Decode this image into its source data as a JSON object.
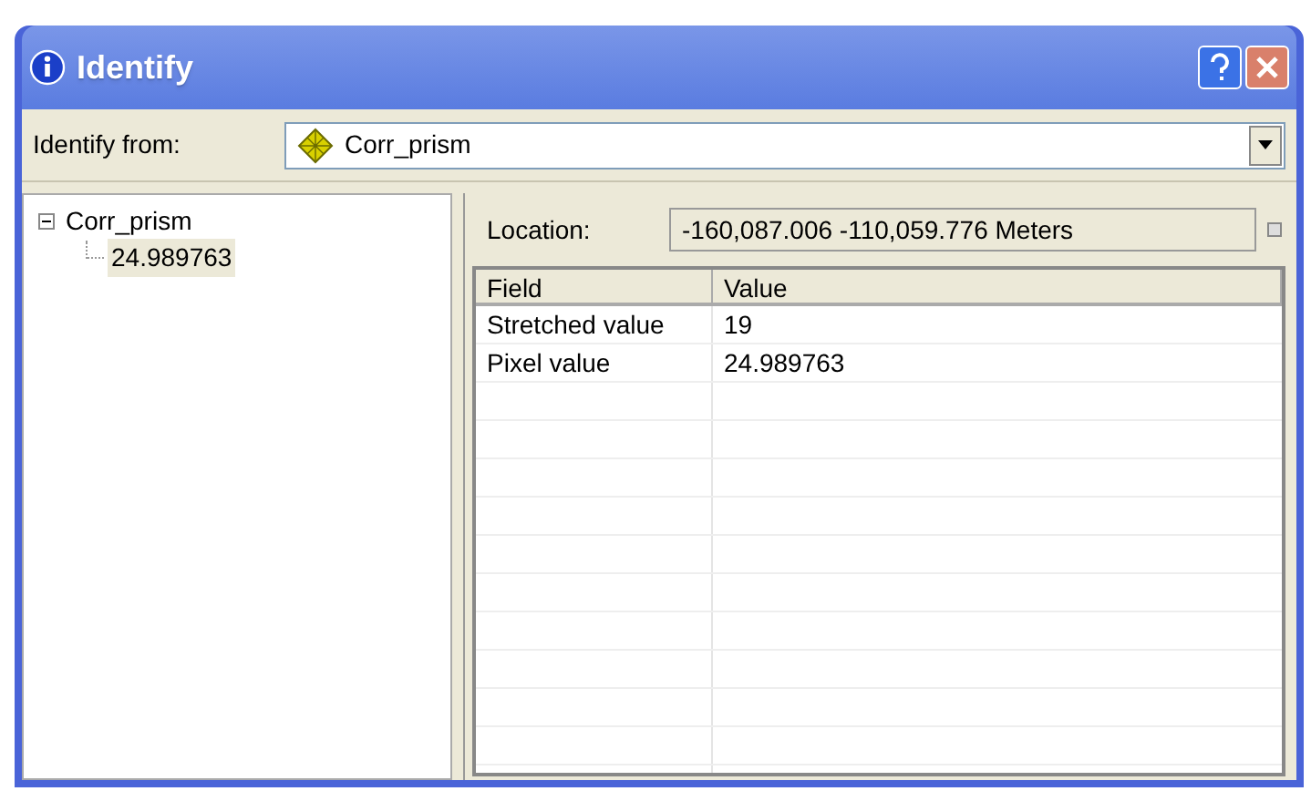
{
  "window": {
    "title": "Identify"
  },
  "identify_from": {
    "label": "Identify from:",
    "value": "Corr_prism"
  },
  "tree": [
    {
      "label": "Corr_prism",
      "expanded": true,
      "selected": false,
      "children": [
        {
          "label": "24.989763",
          "selected": true
        }
      ]
    }
  ],
  "location": {
    "label": "Location:",
    "value": "-160,087.006  -110,059.776 Meters"
  },
  "table": {
    "columns": [
      "Field",
      "Value"
    ],
    "rows": [
      [
        "Stretched value",
        "19"
      ],
      [
        "Pixel value",
        "24.989763"
      ]
    ]
  }
}
